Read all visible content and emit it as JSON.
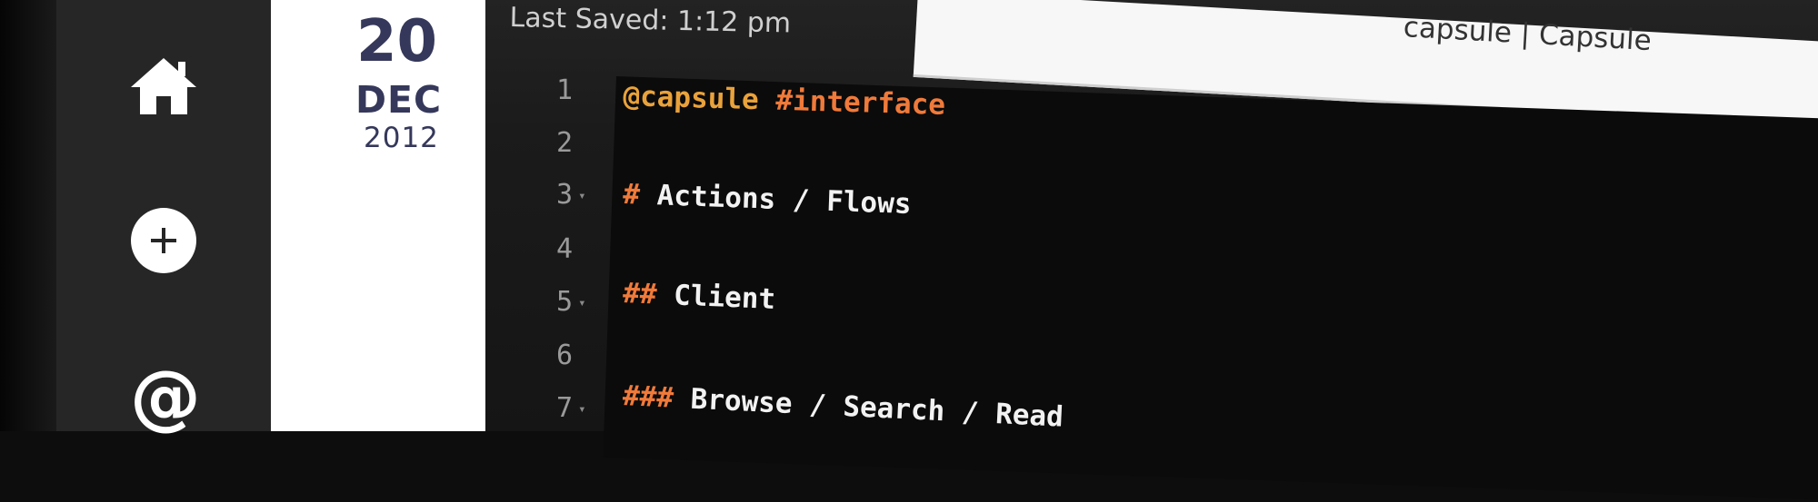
{
  "window": {
    "title": "capsule | Capsule"
  },
  "editor": {
    "last_saved": "Last Saved: 1:12 pm",
    "lines": [
      {
        "number": "1",
        "fold": "",
        "tokens": [
          {
            "text": "@capsule",
            "kind": "mention"
          },
          {
            "text": " ",
            "kind": "text"
          },
          {
            "text": "#interface",
            "kind": "tag"
          }
        ]
      },
      {
        "number": "2",
        "fold": "",
        "tokens": []
      },
      {
        "number": "3",
        "fold": "▾",
        "tokens": [
          {
            "text": "#",
            "kind": "hash"
          },
          {
            "text": " Actions / Flows",
            "kind": "text"
          }
        ]
      },
      {
        "number": "4",
        "fold": "",
        "tokens": []
      },
      {
        "number": "5",
        "fold": "▾",
        "tokens": [
          {
            "text": "##",
            "kind": "hash"
          },
          {
            "text": " Client",
            "kind": "text"
          }
        ]
      },
      {
        "number": "6",
        "fold": "",
        "tokens": []
      },
      {
        "number": "7",
        "fold": "▾",
        "tokens": [
          {
            "text": "###",
            "kind": "hash"
          },
          {
            "text": " Browse / Search / Read",
            "kind": "text"
          }
        ]
      }
    ]
  },
  "date": {
    "day": "20",
    "month": "DEC",
    "year": "2012"
  },
  "nav": {
    "items": [
      {
        "icon": "home-icon"
      },
      {
        "icon": "add-icon"
      },
      {
        "icon": "at-icon"
      }
    ]
  },
  "colors": {
    "sidebar": "#262626",
    "date_text": "#35385a",
    "mention": "#e9a23b",
    "tag": "#f07a3a",
    "code_text": "#f2f2f2"
  }
}
